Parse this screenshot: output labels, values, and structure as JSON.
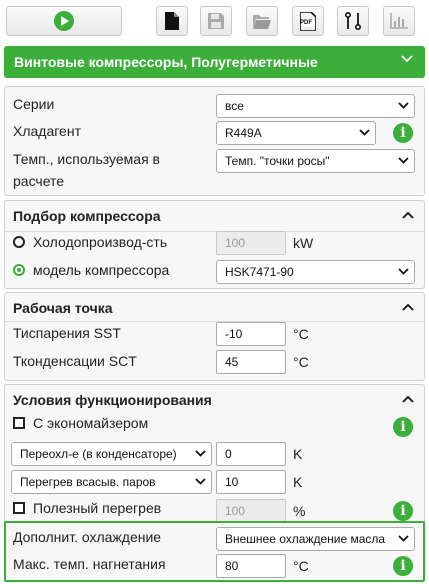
{
  "toolbar": {
    "play_icon": "play-icon",
    "buttons": [
      "new-document-icon",
      "save-icon",
      "open-folder-icon",
      "pdf-icon",
      "compare-icon",
      "chart-icon"
    ],
    "pdf_label": "PDF"
  },
  "banner": {
    "title": "Винтовые компрессоры, Полугерметичные"
  },
  "general": {
    "series_label": "Серии",
    "series_value": "все",
    "refrigerant_label": "Хладагент",
    "refrigerant_value": "R449A",
    "temp_label_1": "Темп., используемая в",
    "temp_label_2": "расчете",
    "temp_value": "Темп. \"точки росы\""
  },
  "selection": {
    "title": "Подбор компрессора",
    "capacity_label": "Холодопроизвод-сть",
    "capacity_value": "100",
    "capacity_unit": "kW",
    "model_label": "модель компрессора",
    "model_value": "HSK7471-90"
  },
  "operating_point": {
    "title": "Рабочая точка",
    "sst_label": "Тиспарения SST",
    "sst_value": "-10",
    "sst_unit": "°C",
    "sct_label": "Тконденсации SCT",
    "sct_value": "45",
    "sct_unit": "°C"
  },
  "conditions": {
    "title": "Условия функционирования",
    "economizer_label": "С экономайзером",
    "subcool_select": "Переохл-е (в конденсаторе)",
    "subcool_value": "0",
    "subcool_unit": "K",
    "superheat_select": "Перегрев всасыв. паров",
    "superheat_value": "10",
    "superheat_unit": "K",
    "useful_superheat_label": "Полезный перегрев",
    "useful_superheat_value": "100",
    "useful_superheat_unit": "%",
    "add_cooling_label": "Дополнит. охлаждение",
    "add_cooling_value": "Внешнее охлаждение масла",
    "max_temp_label": "Макс. темп. нагнетания",
    "max_temp_value": "80",
    "max_temp_unit": "°C"
  },
  "colors": {
    "accent": "#3cae3a"
  },
  "info_glyph": "i"
}
